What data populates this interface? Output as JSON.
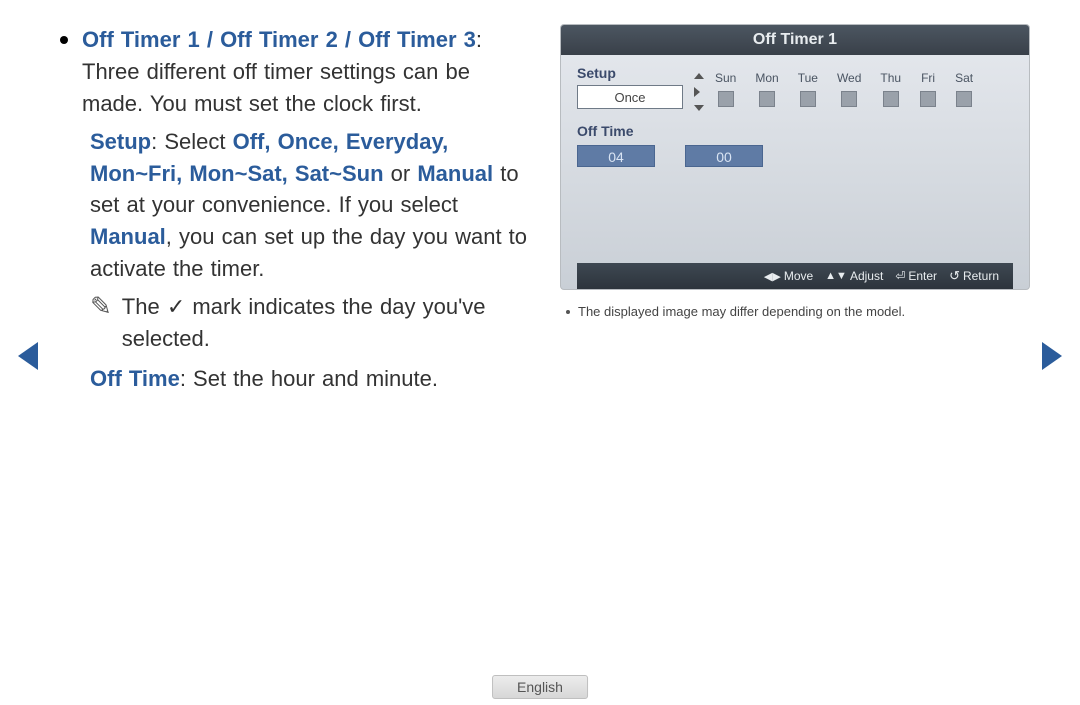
{
  "left": {
    "heading": "Off Timer 1 / Off Timer 2 / Off Timer 3",
    "heading_tail": ": Three different off timer settings can be made. You must set the clock first.",
    "setup_label": "Setup",
    "setup_mid1": ": Select ",
    "setup_options": "Off, Once, Everyday, Mon~Fri, Mon~Sat, Sat~Sun",
    "setup_or": " or ",
    "setup_manual": "Manual",
    "setup_mid2": " to set at your convenience. If you select ",
    "setup_manual2": "Manual",
    "setup_tail": ", you can set up the day you want to activate the timer.",
    "note_pre": "The ",
    "note_check": "✓",
    "note_post": " mark indicates the day you've selected.",
    "offtime_label": "Off Time",
    "offtime_text": ": Set the hour and minute."
  },
  "panel": {
    "title": "Off Timer 1",
    "section_setup": "Setup",
    "setup_value": "Once",
    "days": [
      "Sun",
      "Mon",
      "Tue",
      "Wed",
      "Thu",
      "Fri",
      "Sat"
    ],
    "section_offtime": "Off Time",
    "hour": "04",
    "minute": "00",
    "bar_move": "Move",
    "bar_adjust": "Adjust",
    "bar_enter": "Enter",
    "bar_return": "Return"
  },
  "footnote": "The displayed image may differ depending on the model.",
  "language": "English"
}
